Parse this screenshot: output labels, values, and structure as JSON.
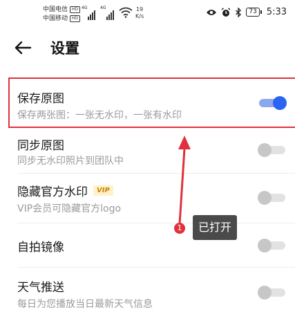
{
  "status_bar": {
    "carrier1": "中国电信",
    "carrier2": "中国移动",
    "hd_label": "HD",
    "network1": "4G",
    "network2": "4G",
    "speed_value": "19",
    "speed_unit": "K/s",
    "battery": "73",
    "time": "5:33",
    "icons": [
      "eye-icon",
      "alarm-icon",
      "bluetooth-icon",
      "battery-icon"
    ]
  },
  "header": {
    "back_icon": "arrow-left-icon",
    "title": "设置"
  },
  "settings": [
    {
      "title": "保存原图",
      "subtitle": "保存两张图：一张无水印，一张有水印",
      "on": true
    },
    {
      "title": "同步原图",
      "subtitle": "同步无水印照片到团队中",
      "on": false
    },
    {
      "title": "隐藏官方水印",
      "badge": "VIP",
      "subtitle": "VIP会员可隐藏官方logo",
      "on": false
    },
    {
      "title": "自拍镜像",
      "on": false
    },
    {
      "title": "天气推送",
      "subtitle": "每日为您播放当日最新天气信息",
      "on": false
    }
  ],
  "annotation": {
    "badge_number": "1",
    "tooltip": "已打开",
    "accent_color": "#e1303b",
    "toggle_on_color": "#2a64f0"
  }
}
